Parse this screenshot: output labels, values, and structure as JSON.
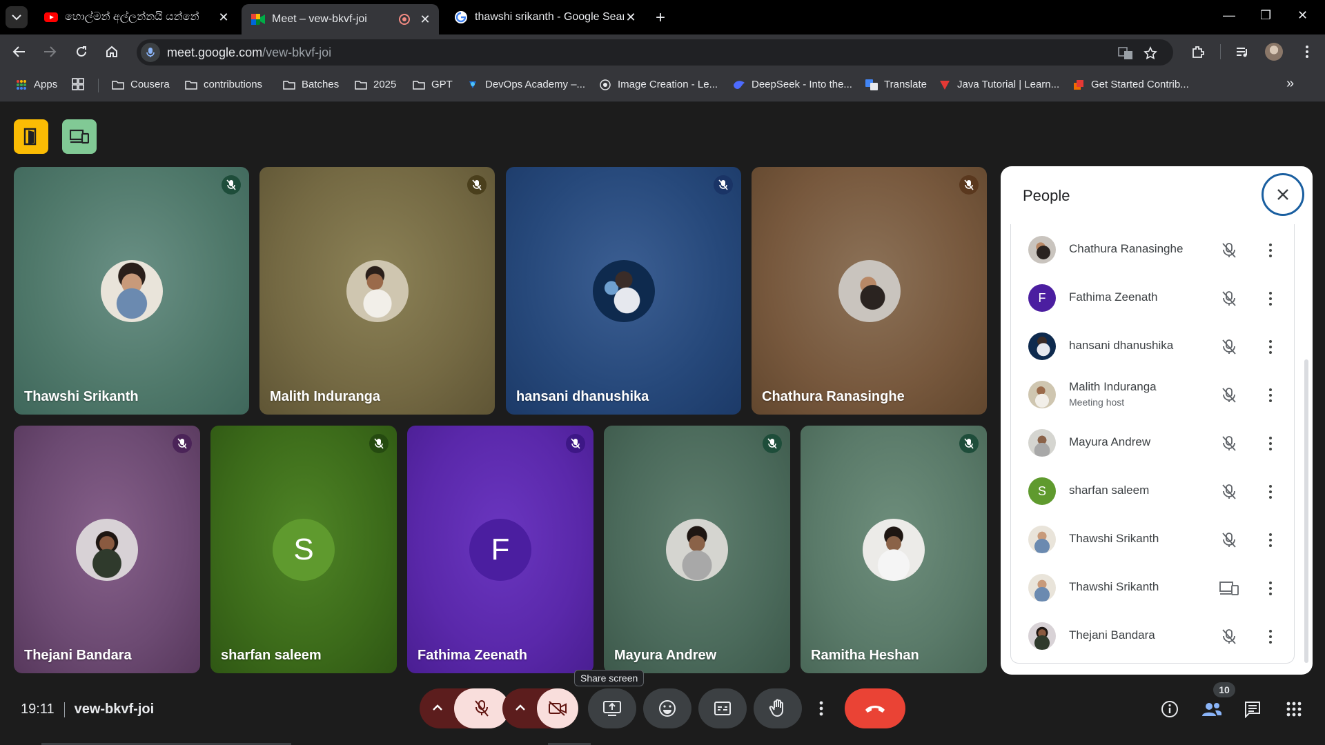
{
  "browser": {
    "tabs": [
      {
        "title": "හොල්මන් අල්ලන්නයි යන්නේ",
        "favicon": "youtube-icon",
        "active": false
      },
      {
        "title": "Meet – vew-bkvf-joi",
        "favicon": "google-meet-icon",
        "active": true
      },
      {
        "title": "thawshi srikanth - Google Search",
        "favicon": "google-icon",
        "active": false
      }
    ],
    "url_host": "meet.google.com",
    "url_path": "/vew-bkvf-joi",
    "bookmarks": [
      {
        "label": "Apps",
        "icon": "apps-grid-icon"
      },
      {
        "label": "",
        "icon": "tab-groups-icon"
      },
      {
        "label": "Cousera",
        "icon": "folder-icon"
      },
      {
        "label": "contributions",
        "icon": "folder-icon"
      },
      {
        "label": "Batches",
        "icon": "folder-icon"
      },
      {
        "label": "2025",
        "icon": "folder-icon"
      },
      {
        "label": "GPT",
        "icon": "folder-icon"
      },
      {
        "label": "DevOps Academy –...",
        "icon": "devops-icon"
      },
      {
        "label": "Image Creation - Le...",
        "icon": "image-creation-icon"
      },
      {
        "label": "DeepSeek - Into the...",
        "icon": "deepseek-icon"
      },
      {
        "label": "Translate",
        "icon": "translate-icon"
      },
      {
        "label": "Java Tutorial | Learn...",
        "icon": "java-icon"
      },
      {
        "label": "Get Started Contrib...",
        "icon": "contrib-icon"
      }
    ]
  },
  "meet": {
    "tiles": [
      {
        "name": "Thawshi Srikanth",
        "bg": "#5d8076",
        "kind": "photo",
        "mute_color": "#1e4d3a"
      },
      {
        "name": "Malith Induranga",
        "bg": "#7a6e46",
        "kind": "photo",
        "mute_color": "#4a3f1c"
      },
      {
        "name": "hansani dhanushika",
        "bg": "#23457a",
        "kind": "photo",
        "mute_color": "#1a3466"
      },
      {
        "name": "Chathura Ranasinghe",
        "bg": "#7d6146",
        "kind": "photo",
        "mute_color": "#5a381e"
      },
      {
        "name": "Thejani Bandara",
        "bg": "#6f4a73",
        "kind": "photo",
        "mute_color": "#4b2458"
      },
      {
        "name": "sharfan saleem",
        "bg": "#3f6e1c",
        "kind": "letter",
        "letter": "S",
        "avatar_color": "#5f9a2e",
        "mute_color": "#254a10"
      },
      {
        "name": "Fathima Zeenath",
        "bg": "#5b2aa8",
        "kind": "letter",
        "letter": "F",
        "avatar_color": "#4b1ea0",
        "mute_color": "#3d1786"
      },
      {
        "name": "Mayura Andrew",
        "bg": "#4f6c5e",
        "kind": "photo",
        "mute_color": "#1e4d3a"
      },
      {
        "name": "Ramitha Heshan",
        "bg": "#5b7a69",
        "kind": "photo",
        "mute_color": "#1e4d3a"
      }
    ],
    "people_panel": {
      "title": "People",
      "participants": [
        {
          "name": "Chathura Ranasinghe",
          "sub": "",
          "status": "mic-off-icon"
        },
        {
          "name": "Fathima Zeenath",
          "sub": "",
          "status": "mic-off-icon",
          "letter": "F",
          "color": "#4b1ea0"
        },
        {
          "name": "hansani dhanushika",
          "sub": "",
          "status": "mic-off-icon"
        },
        {
          "name": "Malith Induranga",
          "sub": "Meeting host",
          "status": "mic-off-icon"
        },
        {
          "name": "Mayura Andrew",
          "sub": "",
          "status": "mic-off-icon"
        },
        {
          "name": "sharfan saleem",
          "sub": "",
          "status": "mic-off-icon",
          "letter": "S",
          "color": "#5f9a2e"
        },
        {
          "name": "Thawshi Srikanth",
          "sub": "",
          "status": "mic-off-icon"
        },
        {
          "name": "Thawshi Srikanth",
          "sub": "",
          "status": "companion-device-icon"
        },
        {
          "name": "Thejani Bandara",
          "sub": "",
          "status": "mic-off-icon"
        }
      ]
    },
    "time": "19:11",
    "meeting_code": "vew-bkvf-joi",
    "tooltip": "Share screen",
    "people_count": "10"
  }
}
